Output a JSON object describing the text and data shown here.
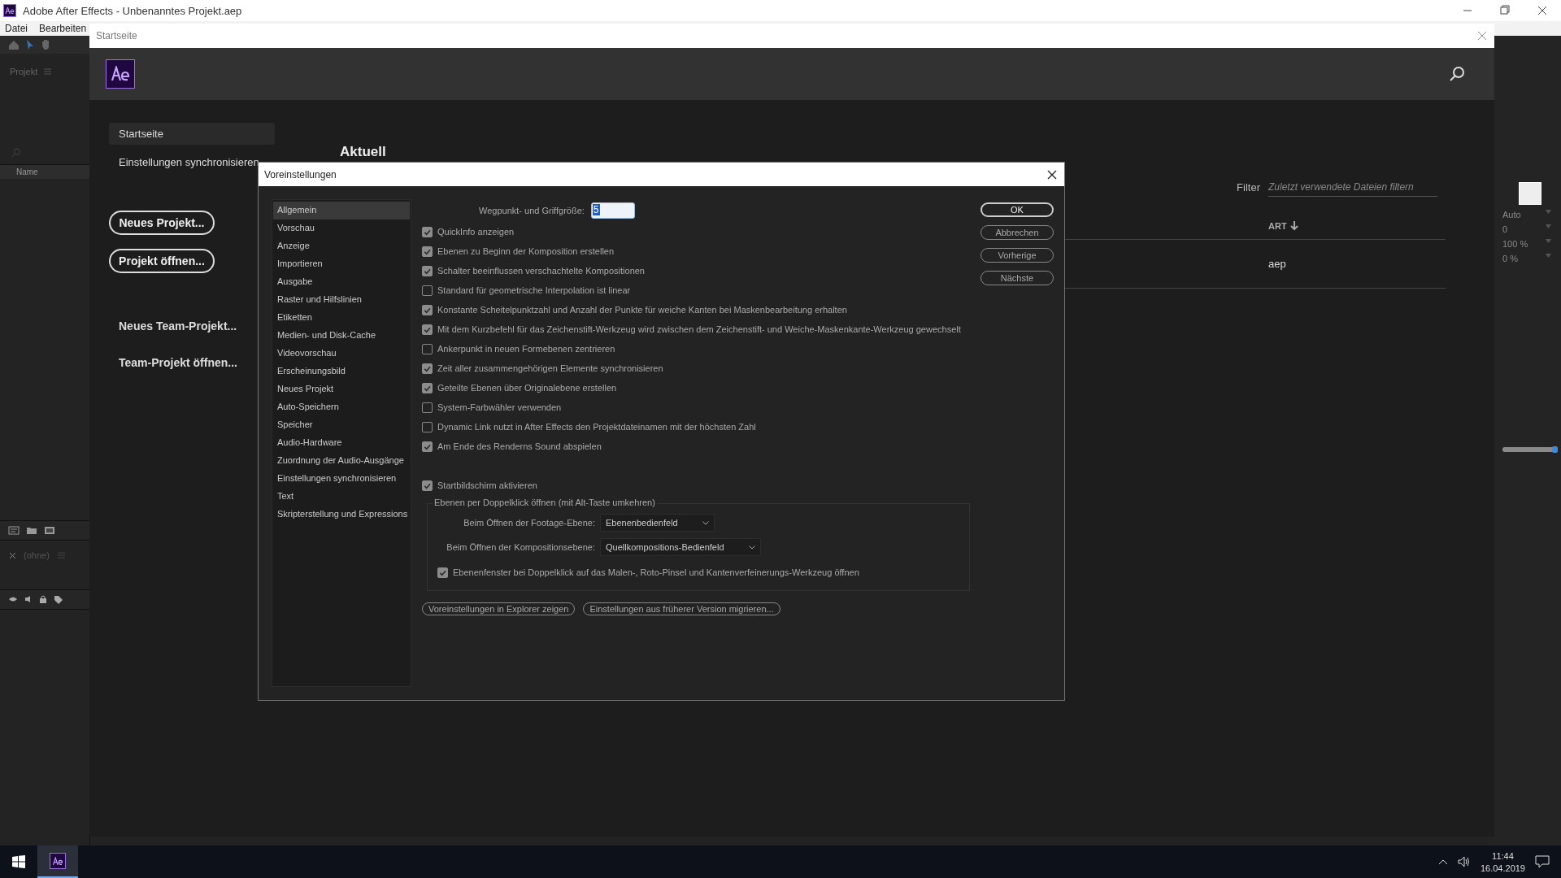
{
  "app_window": {
    "title": "Adobe After Effects - Unbenanntes Projekt.aep"
  },
  "menu": [
    "Datei",
    "Bearbeiten"
  ],
  "project_panel": {
    "title": "Projekt",
    "column": "Name",
    "timeline_tab": "(ohne)"
  },
  "start_window": {
    "title": "Startseite",
    "nav": [
      {
        "label": "Startseite",
        "selected": true
      },
      {
        "label": "Einstellungen synchronisieren",
        "selected": false
      }
    ],
    "buttons": [
      "Neues Projekt...",
      "Projekt öffnen..."
    ],
    "team_links": [
      "Neues Team-Projekt...",
      "Team-Projekt öffnen..."
    ],
    "recent": {
      "heading": "Aktuell",
      "filter_label": "Filter",
      "filter_placeholder": "Zuletzt verwendete Dateien filtern",
      "column": "ART",
      "rows": [
        "aep"
      ]
    }
  },
  "preferences": {
    "title": "Voreinstellungen",
    "categories": [
      {
        "label": "Allgemein",
        "selected": true
      },
      {
        "label": "Vorschau",
        "selected": false
      },
      {
        "label": "Anzeige",
        "selected": false
      },
      {
        "label": "Importieren",
        "selected": false
      },
      {
        "label": "Ausgabe",
        "selected": false
      },
      {
        "label": "Raster und Hilfslinien",
        "selected": false
      },
      {
        "label": "Etiketten",
        "selected": false
      },
      {
        "label": "Medien- und Disk-Cache",
        "selected": false
      },
      {
        "label": "Videovorschau",
        "selected": false
      },
      {
        "label": "Erscheinungsbild",
        "selected": false
      },
      {
        "label": "Neues Projekt",
        "selected": false
      },
      {
        "label": "Auto-Speichern",
        "selected": false
      },
      {
        "label": "Speicher",
        "selected": false
      },
      {
        "label": "Audio-Hardware",
        "selected": false
      },
      {
        "label": "Zuordnung der Audio-Ausgänge",
        "selected": false
      },
      {
        "label": "Einstellungen synchronisieren",
        "selected": false
      },
      {
        "label": "Text",
        "selected": false
      },
      {
        "label": "Skripterstellung und Expressions",
        "selected": false
      }
    ],
    "handle_size": {
      "label": "Wegpunkt- und Griffgröße:",
      "value": "5"
    },
    "options": [
      {
        "label": "QuickInfo anzeigen",
        "checked": true
      },
      {
        "label": "Ebenen zu Beginn der Komposition erstellen",
        "checked": true
      },
      {
        "label": "Schalter beeinflussen verschachtelte Kompositionen",
        "checked": true
      },
      {
        "label": "Standard für geometrische Interpolation ist linear",
        "checked": false
      },
      {
        "label": "Konstante Scheitelpunktzahl und Anzahl der Punkte für weiche Kanten bei Maskenbearbeitung erhalten",
        "checked": true
      },
      {
        "label": "Mit dem Kurzbefehl für das Zeichenstift-Werkzeug wird zwischen dem Zeichenstift- und Weiche-Maskenkante-Werkzeug gewechselt",
        "checked": true
      },
      {
        "label": "Ankerpunkt in neuen Formebenen zentrieren",
        "checked": false
      },
      {
        "label": "Zeit aller zusammengehörigen Elemente synchronisieren",
        "checked": true
      },
      {
        "label": "Geteilte Ebenen über Originalebene erstellen",
        "checked": true
      },
      {
        "label": "System-Farbwähler verwenden",
        "checked": false
      },
      {
        "label": "Dynamic Link nutzt in After Effects den Projektdateinamen mit der höchsten Zahl",
        "checked": false
      },
      {
        "label": "Am Ende des Renderns Sound abspielen",
        "checked": true
      }
    ],
    "start_screen": {
      "label": "Startbildschirm aktivieren",
      "checked": true
    },
    "double_click": {
      "legend": "Ebenen per Doppelklick öffnen (mit Alt-Taste umkehren)",
      "selects": [
        {
          "label": "Beim Öffnen der Footage-Ebene:",
          "value": "Ebenenbedienfeld"
        },
        {
          "label": "Beim Öffnen der Kompositionsebene:",
          "value": "Quellkompositions-Bedienfeld"
        }
      ],
      "option": {
        "label": "Ebenenfenster bei Doppelklick auf das Malen-, Roto-Pinsel und Kantenverfeinerungs-Werkzeug öffnen",
        "checked": true
      }
    },
    "footer_buttons": [
      "Voreinstellungen in Explorer zeigen",
      "Einstellungen aus früherer Version migrieren..."
    ],
    "side_buttons": [
      "OK",
      "Abbrechen",
      "Vorherige",
      "Nächste"
    ]
  },
  "right_panel": {
    "values": [
      "Auto",
      "0",
      "100 %",
      "0 %"
    ],
    "slider": {
      "level": 0.97
    }
  },
  "taskbar": {
    "time": "11:44",
    "date": "16.04.2019"
  }
}
